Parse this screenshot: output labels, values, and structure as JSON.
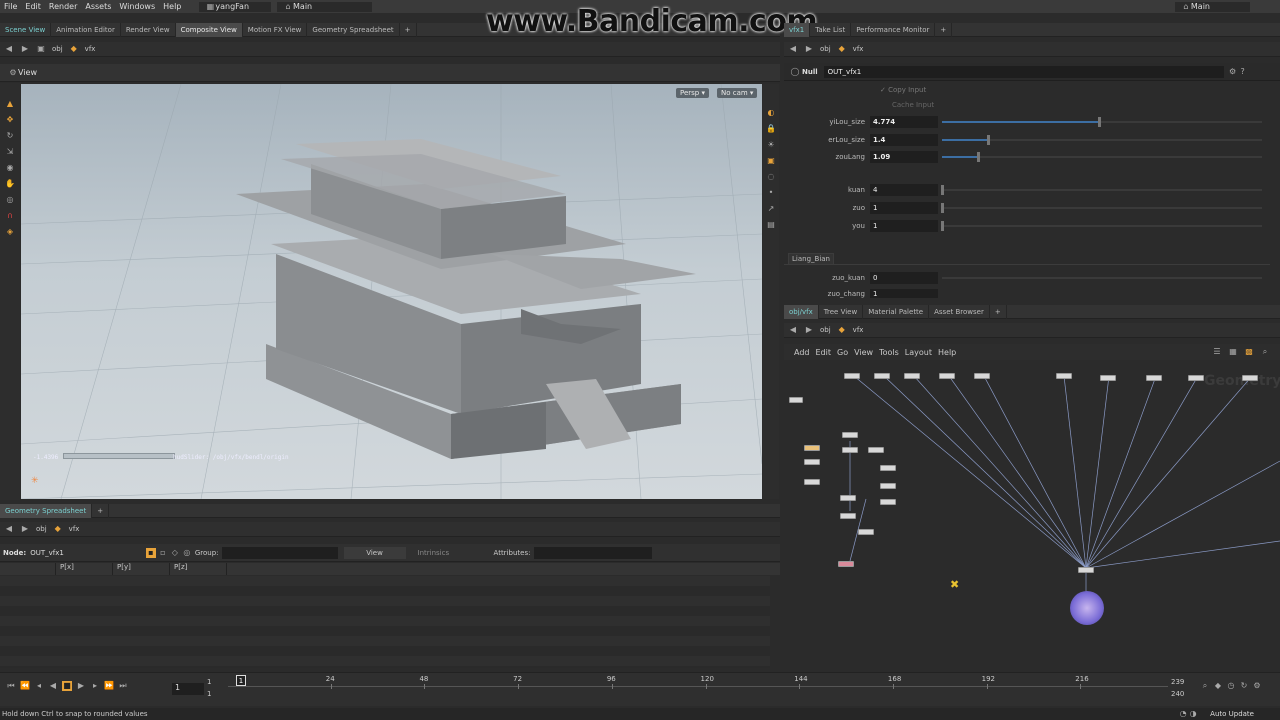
{
  "menu": [
    "File",
    "Edit",
    "Render",
    "Assets",
    "Windows",
    "Help"
  ],
  "desktop": "yangFan",
  "workspace_left": "Main",
  "workspace_right": "Main",
  "watermark": "www.Bandicam.com",
  "left_tabs": [
    "Scene View",
    "Animation Editor",
    "Render View",
    "Composite View",
    "Motion FX View",
    "Geometry Spreadsheet"
  ],
  "path": {
    "obj": "obj",
    "vfx": "vfx"
  },
  "viewer": {
    "title": "View",
    "persp": "Persp",
    "cam": "No cam",
    "handle_value": "-1.4396",
    "handle_path": "hudSlider: /obj/vfx/bendl/origin"
  },
  "right_tabs": [
    "vfx1",
    "Take List",
    "Performance Monitor"
  ],
  "param_node": {
    "type": "Null",
    "name": "OUT_vfx1",
    "copy_input": "Copy Input",
    "cache_input": "Cache Input"
  },
  "params": [
    {
      "label": "yiLou_size",
      "value": "4.774",
      "fill": 0.48
    },
    {
      "label": "erLou_size",
      "value": "1.4",
      "fill": 0.14
    },
    {
      "label": "zouLang",
      "value": "1.09",
      "fill": 0.11
    },
    {
      "label": "kuan",
      "value": "4",
      "fill": 0
    },
    {
      "label": "zuo",
      "value": "1",
      "fill": 0
    },
    {
      "label": "you",
      "value": "1",
      "fill": 0
    }
  ],
  "section": "Liang_Bian",
  "params2": [
    {
      "label": "zuo_kuan",
      "value": "0"
    },
    {
      "label": "zuo_chang",
      "value": "1"
    }
  ],
  "net_tabs": [
    "obj/vfx",
    "Tree View",
    "Material Palette",
    "Asset Browser"
  ],
  "net_menu": [
    "Add",
    "Edit",
    "Go",
    "View",
    "Tools",
    "Layout",
    "Help"
  ],
  "net_watermark": "Geometry",
  "spread": {
    "tab": "Geometry Spreadsheet",
    "node_label": "Node:",
    "node_name": "OUT_vfx1",
    "group_label": "Group:",
    "view_label": "View",
    "intrinsics": "Intrinsics",
    "attributes_label": "Attributes:",
    "columns": [
      "P[x]",
      "P[y]",
      "P[z]"
    ]
  },
  "timeline": {
    "frame": "1",
    "range_start": "1",
    "range_start2": "1",
    "ticks": [
      "24",
      "48",
      "72",
      "96",
      "120",
      "144",
      "168",
      "192",
      "216"
    ],
    "end1": "239",
    "end2": "240",
    "current": "1"
  },
  "status": {
    "message": "Hold down Ctrl to snap to rounded values",
    "auto_update": "Auto Update"
  },
  "colors": {
    "accent": "#e8a33a",
    "param_fill": "#3c6ea3"
  }
}
